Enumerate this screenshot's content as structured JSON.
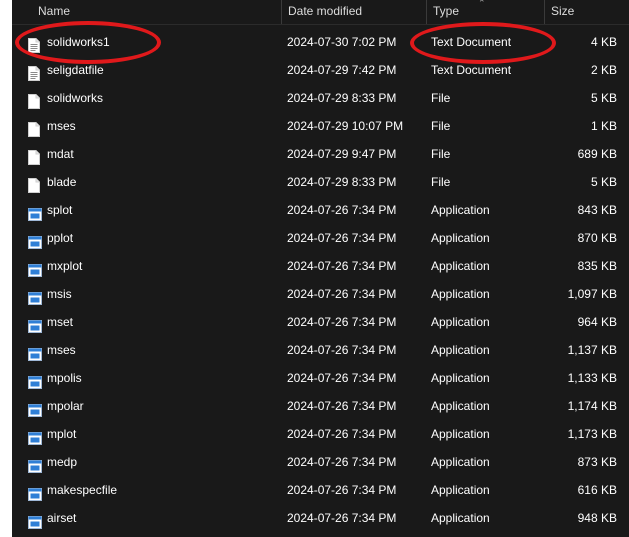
{
  "columns": {
    "name": "Name",
    "date": "Date modified",
    "type": "Type",
    "size": "Size"
  },
  "files": [
    {
      "name": "solidworks1",
      "date": "2024-07-30 7:02 PM",
      "type": "Text Document",
      "size": "4 KB",
      "icon": "text-document-icon"
    },
    {
      "name": "seligdatfile",
      "date": "2024-07-29 7:42 PM",
      "type": "Text Document",
      "size": "2 KB",
      "icon": "text-document-icon"
    },
    {
      "name": "solidworks",
      "date": "2024-07-29 8:33 PM",
      "type": "File",
      "size": "5 KB",
      "icon": "file-icon"
    },
    {
      "name": "mses",
      "date": "2024-07-29 10:07 PM",
      "type": "File",
      "size": "1 KB",
      "icon": "file-icon"
    },
    {
      "name": "mdat",
      "date": "2024-07-29 9:47 PM",
      "type": "File",
      "size": "689 KB",
      "icon": "file-icon"
    },
    {
      "name": "blade",
      "date": "2024-07-29 8:33 PM",
      "type": "File",
      "size": "5 KB",
      "icon": "file-icon"
    },
    {
      "name": "splot",
      "date": "2024-07-26 7:34 PM",
      "type": "Application",
      "size": "843 KB",
      "icon": "application-icon"
    },
    {
      "name": "pplot",
      "date": "2024-07-26 7:34 PM",
      "type": "Application",
      "size": "870 KB",
      "icon": "application-icon"
    },
    {
      "name": "mxplot",
      "date": "2024-07-26 7:34 PM",
      "type": "Application",
      "size": "835 KB",
      "icon": "application-icon"
    },
    {
      "name": "msis",
      "date": "2024-07-26 7:34 PM",
      "type": "Application",
      "size": "1,097 KB",
      "icon": "application-icon"
    },
    {
      "name": "mset",
      "date": "2024-07-26 7:34 PM",
      "type": "Application",
      "size": "964 KB",
      "icon": "application-icon"
    },
    {
      "name": "mses",
      "date": "2024-07-26 7:34 PM",
      "type": "Application",
      "size": "1,137 KB",
      "icon": "application-icon"
    },
    {
      "name": "mpolis",
      "date": "2024-07-26 7:34 PM",
      "type": "Application",
      "size": "1,133 KB",
      "icon": "application-icon"
    },
    {
      "name": "mpolar",
      "date": "2024-07-26 7:34 PM",
      "type": "Application",
      "size": "1,174 KB",
      "icon": "application-icon"
    },
    {
      "name": "mplot",
      "date": "2024-07-26 7:34 PM",
      "type": "Application",
      "size": "1,173 KB",
      "icon": "application-icon"
    },
    {
      "name": "medp",
      "date": "2024-07-26 7:34 PM",
      "type": "Application",
      "size": "873 KB",
      "icon": "application-icon"
    },
    {
      "name": "makespecfile",
      "date": "2024-07-26 7:34 PM",
      "type": "Application",
      "size": "616 KB",
      "icon": "application-icon"
    },
    {
      "name": "airset",
      "date": "2024-07-26 7:34 PM",
      "type": "Application",
      "size": "948 KB",
      "icon": "application-icon"
    }
  ],
  "colors": {
    "background": "#191919",
    "text": "#ffffff",
    "annotation": "#e0191b",
    "app_icon_blue": "#2f7fd6"
  }
}
